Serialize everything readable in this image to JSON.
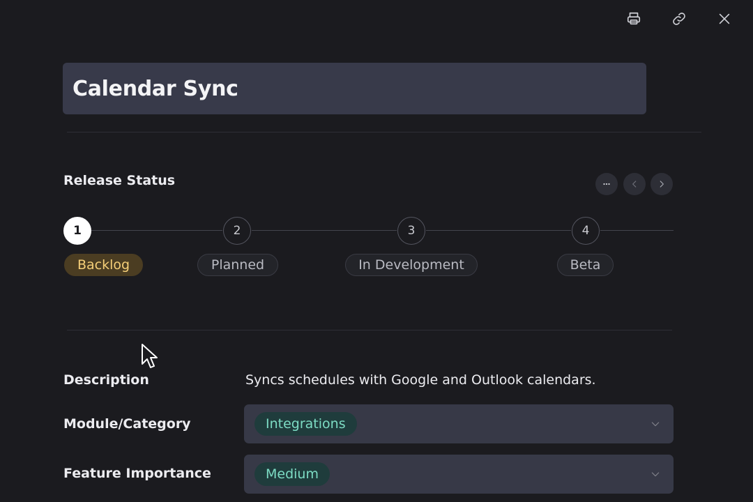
{
  "toolbar": {
    "print_icon": "printer-icon",
    "link_icon": "link-icon",
    "close_icon": "close-icon"
  },
  "record": {
    "title": "Calendar Sync"
  },
  "release_status": {
    "label": "Release Status",
    "more_label": "···",
    "steps": [
      {
        "number": "1",
        "label": "Backlog",
        "active": true
      },
      {
        "number": "2",
        "label": "Planned",
        "active": false
      },
      {
        "number": "3",
        "label": "In Development",
        "active": false
      },
      {
        "number": "4",
        "label": "Beta",
        "active": false
      }
    ]
  },
  "fields": {
    "description": {
      "label": "Description",
      "value": "Syncs schedules with Google and Outlook calendars."
    },
    "module": {
      "label": "Module/Category",
      "value": "Integrations"
    },
    "importance": {
      "label": "Feature Importance",
      "value": "Medium"
    }
  },
  "colors": {
    "background": "#1b1b1f",
    "active_step_pill": "#4b3d22",
    "active_step_text": "#f5cf78",
    "tag_text": "#7ddcc4"
  }
}
